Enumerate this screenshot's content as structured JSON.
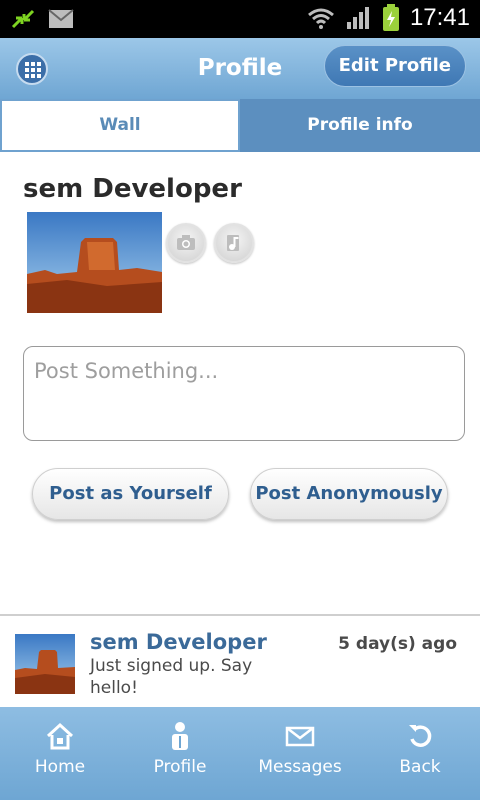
{
  "status_bar": {
    "time": "17:41"
  },
  "header": {
    "title": "Profile",
    "edit_button": "Edit Profile"
  },
  "tabs": [
    {
      "label": "Wall"
    },
    {
      "label": "Profile info"
    }
  ],
  "profile": {
    "name": "sem Developer"
  },
  "composer": {
    "placeholder": "Post Something...",
    "post_self_label": "Post as Yourself",
    "post_anon_label": "Post Anonymously"
  },
  "feed": [
    {
      "author": "sem Developer",
      "time": "5 day(s) ago",
      "text": "Just signed up. Say hello!"
    }
  ],
  "bottom_nav": [
    {
      "label": "Home",
      "icon": "home-icon"
    },
    {
      "label": "Profile",
      "icon": "person-icon"
    },
    {
      "label": "Messages",
      "icon": "envelope-icon"
    },
    {
      "label": "Back",
      "icon": "back-arrow-icon"
    }
  ],
  "colors": {
    "accent": "#6fa6d3",
    "link": "#3b6a99"
  }
}
